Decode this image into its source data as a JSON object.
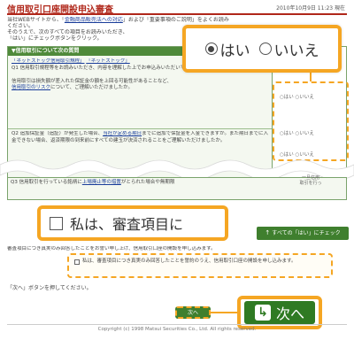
{
  "header": {
    "title": "信用取引口座開設申込審査",
    "date": "2010年10月9日 11:23 現在"
  },
  "intro": {
    "line1_pre": "当社WEBサイトから、「",
    "line1_link": "金融商品販売法への対応",
    "line1_post": "」および「重要事項のご説明」をよくお読み",
    "line2": "ください。",
    "line3": "そのうえで、次のすべての項目をお読みいただき、",
    "line4": "「はい」にチェックボタンをクリック。"
  },
  "table": {
    "header": "▼信用取引について次の質問",
    "q1_link1": "「ネットストック信用取引規程」",
    "q1_link2": "「ネットストック」",
    "q1_text": "Q1 信用取引規程等をお読みいただき、内容を理解した上でお申込みいただいていますか。",
    "q1_note": "信用取引は損失額が差入れた保証金の額を上回る可能性があることなど、",
    "q1_link3": "信用取引のリスク",
    "q1_note2": "について、ご理解いただけましたか。",
    "q2_text": "Q2 追加保証金（追証）が発生した場合、",
    "q2_link": "当社が定める期日",
    "q2_text2": "までに追加で保証金を入金できますか。また期日までに入金できない場合、返済期限の到来前にすべての建玉が決済されることをご理解いただけましたか。"
  },
  "yesno_callout": {
    "yes": "はい",
    "no": "いいえ"
  },
  "yesno_small": {
    "row1": "○はい ○いいえ",
    "row2": "○はい ○いいえ",
    "row3": "○はい ○いいえ"
  },
  "q3": {
    "text_pre": "Q3 信用取引を行っている銘柄に",
    "link": "上場廃止等の措置",
    "text_post": "がとられた場合や無期限",
    "note": "一旦信用\n取引を行っ"
  },
  "agree_callout": {
    "text": "私は、審査項目に"
  },
  "all_yes_button": {
    "label": "すべての「はい」にチェック"
  },
  "note_line": "審査項目につき真実のみ回答したことをお誓い申し上げ、信用取引口座の開設を申し込みます。",
  "agree_small": {
    "text": "私は、審査項目につき真実のみ回答したことを誓約のうえ、信用取引口座の開設を申し込みます。"
  },
  "next_instruction": "「次へ」ボタンを押してください。",
  "small_next": {
    "label": "次へ"
  },
  "big_next": {
    "label": "次へ",
    "icon": "return-arrow-icon"
  },
  "footer": {
    "copyright": "Copyright (c) 1998 Matsui Securities Co., Ltd. All rights reserved."
  },
  "colors": {
    "title_red": "#b0271a",
    "highlight_orange": "#f5a623",
    "button_green": "#2f7a23",
    "table_green": "#4f8a3a",
    "link_blue": "#1a3d9a"
  }
}
